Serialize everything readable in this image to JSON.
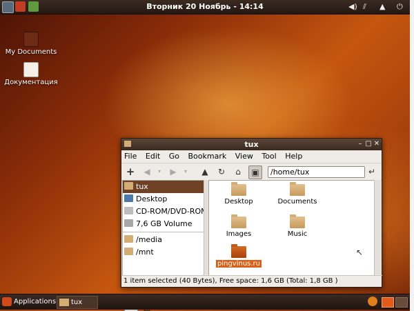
{
  "desktop": {
    "icons": [
      {
        "label": "My Documents",
        "icon": "folder-icon"
      },
      {
        "label": "Документация",
        "icon": "document-icon"
      }
    ]
  },
  "top_panel": {
    "clock": "Вторник 20 Ноябрь - 14:14",
    "launchers": [
      "terminal-icon",
      "tools-icon",
      "network-icon"
    ]
  },
  "window": {
    "title": "tux",
    "menu": [
      "File",
      "Edit",
      "Go",
      "Bookmark",
      "View",
      "Tool",
      "Help"
    ],
    "location": "/home/tux",
    "sidebar": {
      "items": [
        {
          "label": "tux",
          "selected": true
        },
        {
          "label": "Desktop"
        },
        {
          "label": "CD-ROM/DVD-ROM D"
        },
        {
          "label": "7,6 GB Volume"
        },
        {
          "label": "/media"
        },
        {
          "label": "/mnt"
        }
      ]
    },
    "files": [
      {
        "label": "Desktop"
      },
      {
        "label": "Documents"
      },
      {
        "label": "Images"
      },
      {
        "label": "Music"
      },
      {
        "label": "pingvinus.ru",
        "selected": true
      }
    ],
    "status": "1 item selected (40 Bytes), Free space: 1,6 GB (Total: 1,8 GB )"
  },
  "bottom_panel": {
    "menu_label": "Applications",
    "task": "tux"
  },
  "colors": {
    "accent": "#d85f16",
    "panel": "#2e2019",
    "selection": "#6e4127"
  }
}
